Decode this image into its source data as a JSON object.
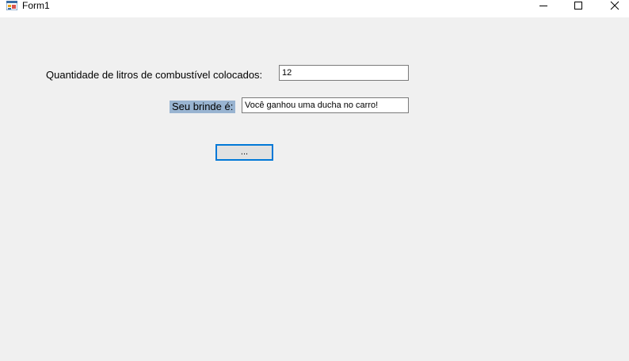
{
  "window": {
    "title": "Form1",
    "icon": "winforms-app-icon",
    "controls": [
      "minimize-icon",
      "maximize-icon",
      "close-icon"
    ]
  },
  "form": {
    "quantity_label": "Quantidade de litros de combustível colocados:",
    "quantity_value": "12",
    "gift_label": "Seu brinde é:",
    "gift_value": "Você ganhou uma ducha no carro!",
    "button_label": "..."
  },
  "colors": {
    "background": "#f0f0f0",
    "label_highlight": "#99b4d1",
    "button_focus_border": "#0078d7"
  }
}
